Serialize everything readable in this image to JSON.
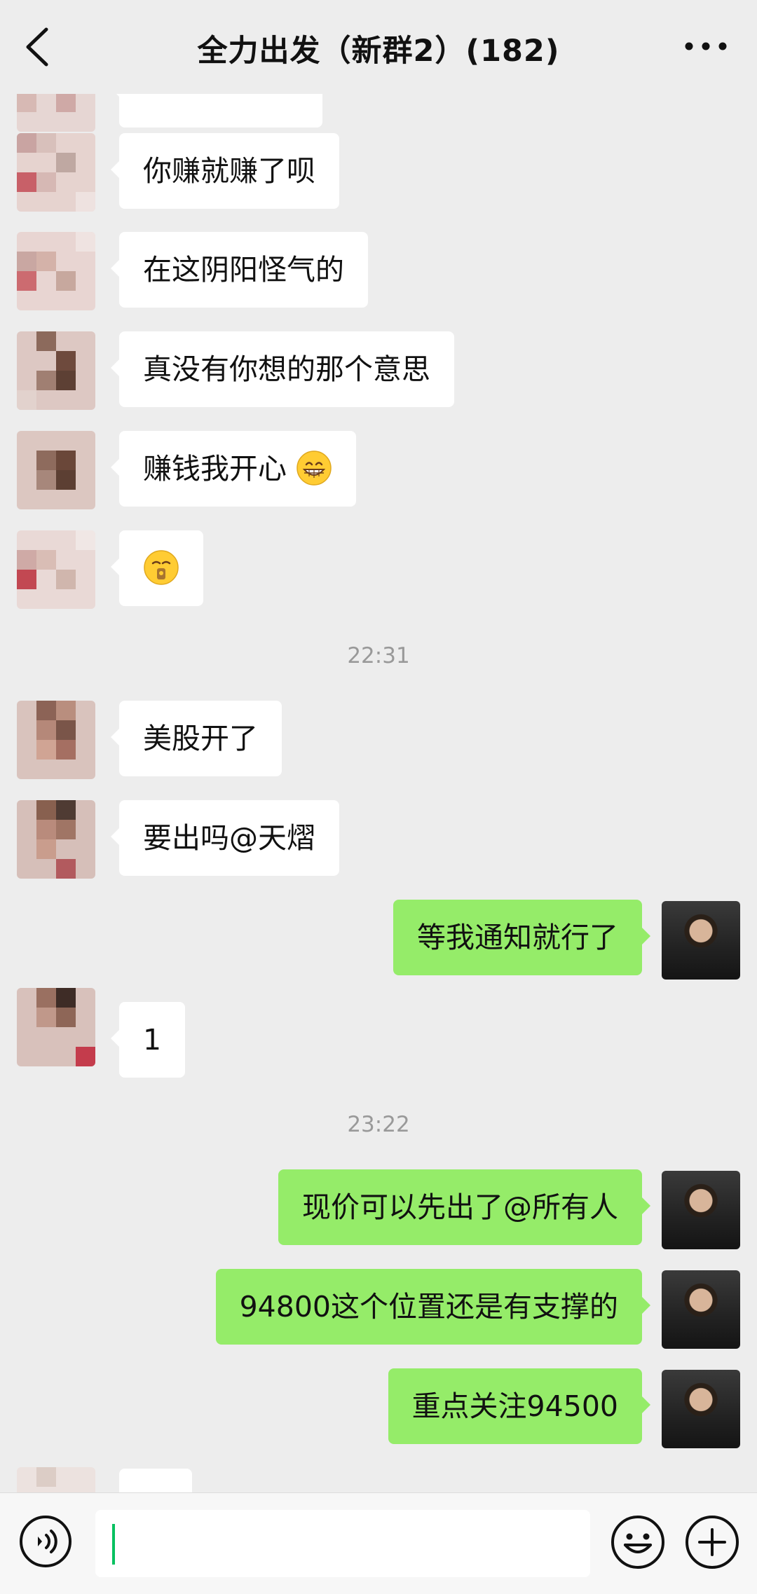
{
  "header": {
    "title": "全力出发（新群2）(182)",
    "back_icon": "chevron-left-icon",
    "more_icon": "ellipsis-icon"
  },
  "messages": [
    {
      "side": "in",
      "text": "你赚就赚了呗"
    },
    {
      "side": "in",
      "text": "在这阴阳怪气的"
    },
    {
      "side": "in",
      "text": "真没有你想的那个意思"
    },
    {
      "side": "in",
      "text": "赚钱我开心",
      "emoji": "grinning-face-emoji"
    },
    {
      "side": "in",
      "text": "",
      "emoji": "zipper-mouth-face-emoji"
    },
    {
      "type": "timestamp",
      "text": "22:31"
    },
    {
      "side": "in",
      "text": "美股开了"
    },
    {
      "side": "in",
      "text": "要出吗@天熠"
    },
    {
      "side": "out",
      "text": "等我通知就行了"
    },
    {
      "side": "in",
      "text": "1"
    },
    {
      "type": "timestamp",
      "text": "23:22"
    },
    {
      "side": "out",
      "text": "现价可以先出了@所有人"
    },
    {
      "side": "out",
      "text": "94800这个位置还是有支撑的"
    },
    {
      "side": "out",
      "text": "重点关注94500"
    }
  ],
  "input": {
    "value": "",
    "voice_icon": "voice-icon",
    "emoji_icon": "smiley-icon",
    "plus_icon": "plus-circle-icon"
  },
  "colors": {
    "background": "#ededed",
    "incoming_bubble": "#ffffff",
    "outgoing_bubble": "#95ec69",
    "caret": "#07c160"
  }
}
